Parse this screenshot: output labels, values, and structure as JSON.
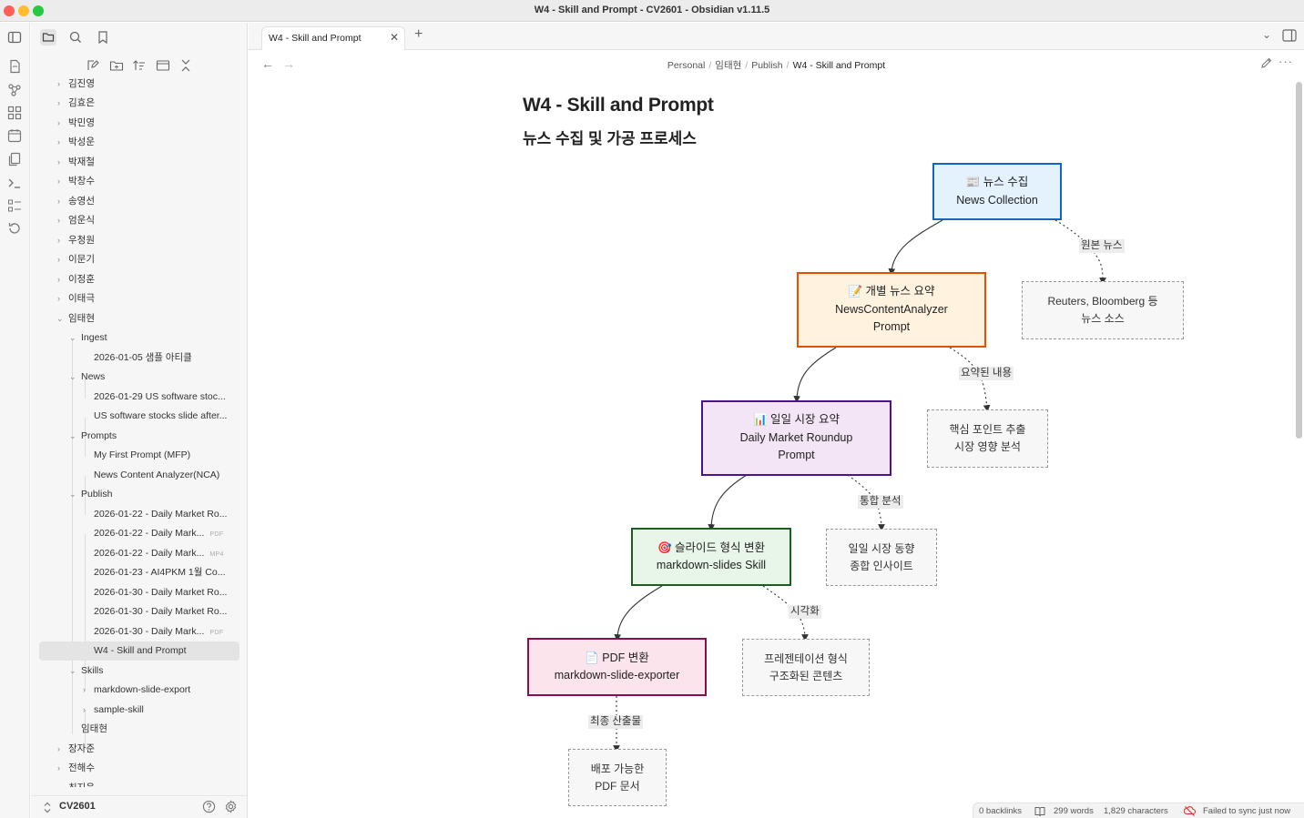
{
  "window": {
    "title": "W4 - Skill and Prompt - CV2601 - Obsidian v1.11.5"
  },
  "tabs": [
    {
      "label": "W4 - Skill and Prompt"
    }
  ],
  "breadcrumb": {
    "parts": [
      "Personal",
      "임태현",
      "Publish"
    ],
    "current": "W4 - Skill and Prompt"
  },
  "vault": {
    "name": "CV2601"
  },
  "tree": {
    "root_folders": [
      "김진영",
      "김효은",
      "박민영",
      "박성운",
      "박재철",
      "박창수",
      "송영선",
      "엄운식",
      "우청원",
      "이문기",
      "이정훈",
      "이태극",
      "임태현"
    ],
    "imtaehyun": {
      "ingest": {
        "label": "Ingest",
        "files": [
          "2026-01-05 샘플 아티클"
        ]
      },
      "news": {
        "label": "News",
        "files": [
          "2026-01-29 US software stoc...",
          "US software stocks slide after..."
        ]
      },
      "prompts": {
        "label": "Prompts",
        "files": [
          "My First Prompt (MFP)",
          "News Content Analyzer(NCA)"
        ]
      },
      "publish": {
        "label": "Publish",
        "files": [
          {
            "name": "2026-01-22 - Daily Market Ro...",
            "badge": ""
          },
          {
            "name": "2026-01-22 - Daily Mark...",
            "badge": "PDF"
          },
          {
            "name": "2026-01-22 - Daily Mark...",
            "badge": "MP4"
          },
          {
            "name": "2026-01-23 - AI4PKM 1월 Co...",
            "badge": ""
          },
          {
            "name": "2026-01-30 - Daily Market Ro...",
            "badge": ""
          },
          {
            "name": "2026-01-30 - Daily Market Ro...",
            "badge": ""
          },
          {
            "name": "2026-01-30 - Daily Mark...",
            "badge": "PDF"
          },
          {
            "name": "W4 - Skill and Prompt",
            "badge": ""
          }
        ]
      },
      "skills": {
        "label": "Skills",
        "folders": [
          "markdown-slide-export",
          "sample-skill"
        ]
      },
      "file": "임태현"
    },
    "after_folders": [
      "장자준",
      "전해수",
      "최지웅"
    ]
  },
  "note": {
    "title": "W4 - Skill and Prompt",
    "subtitle": "뉴스 수집 및 가공 프로세스"
  },
  "diagram": {
    "nodes": [
      {
        "icon": "📰",
        "line1": "뉴스 수집",
        "line2": "News Collection",
        "line3": ""
      },
      {
        "icon": "📝",
        "line1": "개별 뉴스 요약",
        "line2": "NewsContentAnalyzer",
        "line3": "Prompt"
      },
      {
        "icon": "📊",
        "line1": "일일 시장 요약",
        "line2": "Daily Market Roundup",
        "line3": "Prompt"
      },
      {
        "icon": "🎯",
        "line1": "슬라이드 형식 변환",
        "line2": "markdown-slides Skill",
        "line3": ""
      },
      {
        "icon": "📄",
        "line1": "PDF 변환",
        "line2": "markdown-slide-exporter",
        "line3": ""
      }
    ],
    "notes": [
      {
        "line1": "Reuters, Bloomberg 등",
        "line2": "뉴스 소스"
      },
      {
        "line1": "핵심 포인트 추출",
        "line2": "시장 영향 분석"
      },
      {
        "line1": "일일 시장 동향",
        "line2": "종합 인사이트"
      },
      {
        "line1": "프레젠테이션 형식",
        "line2": "구조화된 콘텐츠"
      },
      {
        "line1": "배포 가능한",
        "line2": "PDF 문서"
      }
    ],
    "edge_labels": [
      "원본 뉴스",
      "요약된 내용",
      "통합 분석",
      "시각화",
      "최종 산출물"
    ]
  },
  "status": {
    "backlinks": "0 backlinks",
    "words": "299 words",
    "characters": "1,829 characters",
    "sync": "Failed to sync just now"
  },
  "colors": {
    "node_blue_fill": "#e3f2fd",
    "node_blue_border": "#1565c0",
    "node_orange_fill": "#fff3e0",
    "node_orange_border": "#e65100",
    "node_purple_fill": "#f3e5f5",
    "node_purple_border": "#4a148c",
    "node_green_fill": "#e8f5e9",
    "node_green_border": "#1b5e20",
    "node_pink_fill": "#fce4ec",
    "node_pink_border": "#880e4f",
    "sync_error": "#e03131"
  }
}
